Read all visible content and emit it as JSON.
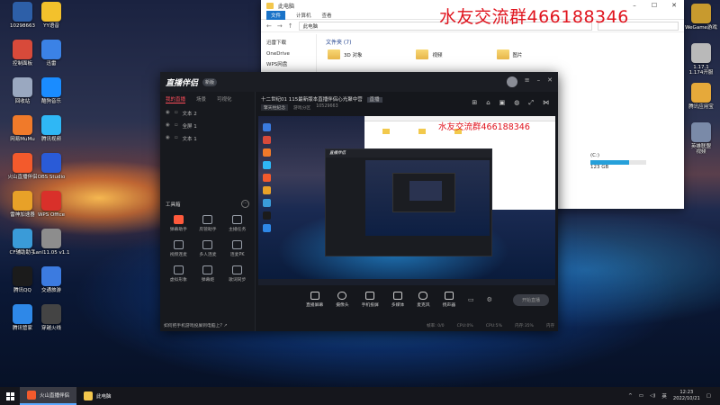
{
  "desktop": {
    "icons": [
      {
        "label": "10298663",
        "color": "#2d5fa8"
      },
      {
        "label": "YY语音",
        "color": "#f3c12c"
      },
      {
        "label": "控制面板",
        "color": "#d84a3a"
      },
      {
        "label": "迅雷",
        "color": "#3b82e6"
      },
      {
        "label": "回收站",
        "color": "#9aa8c0"
      },
      {
        "label": "酷狗音乐",
        "color": "#1a8cff"
      },
      {
        "label": "网易MuMu",
        "color": "#f07a2a"
      },
      {
        "label": "腾讯视频",
        "color": "#2fb7f5"
      },
      {
        "label": "火山直播伴侣",
        "color": "#f35a2c"
      },
      {
        "label": "OBS Studio",
        "color": "#2a5bd7"
      },
      {
        "label": "雷神加速器",
        "color": "#e8a128"
      },
      {
        "label": "WPS Office",
        "color": "#d9302a"
      },
      {
        "label": "CF辅助助手",
        "color": "#3a9bd8"
      },
      {
        "label": "Lanl11.05 v1.1",
        "color": "#8d8d8d"
      },
      {
        "label": "腾讯QQ",
        "color": "#1b1b1b"
      },
      {
        "label": "交通旅游",
        "color": "#3c7be0"
      },
      {
        "label": "腾讯管家",
        "color": "#2e88e8"
      },
      {
        "label": "穿越火线",
        "color": "#444"
      }
    ],
    "right_icons": [
      {
        "label": "WeGame游戏",
        "color": "#c89a2e"
      },
      {
        "label": "1.17.1\n1.174开服",
        "color": "#b9b9b9"
      },
      {
        "label": "腾讯应用宝",
        "color": "#e6a93a"
      },
      {
        "label": "英雄联盟\n视频",
        "color": "#7a8aa8"
      }
    ]
  },
  "explorer": {
    "title": "此电脑",
    "ribbon_tabs": [
      "文件",
      "计算机",
      "查看"
    ],
    "address": "此电脑",
    "sidebar": [
      "迅雷下载",
      "OneDrive",
      "WPS网盘"
    ],
    "group_title": "文件夹 (7)",
    "folders": [
      "3D 对象",
      "视频",
      "图片"
    ],
    "drive_label": "(C:)",
    "drive_size": "123 GB",
    "drive_fill": 0.7
  },
  "watermark": "水友交流群466188346",
  "app": {
    "logo": "直播伴侣",
    "badge": "新版",
    "tabs": [
      "我的直播",
      "场景",
      "可视化"
    ],
    "sources": [
      "文本 2",
      "全屏 1",
      "文本 1"
    ],
    "tools_title": "工具箱",
    "tools": [
      {
        "label": "弹幕助手",
        "hot": true
      },
      {
        "label": "房管助手",
        "hot": false
      },
      {
        "label": "主播任务",
        "hot": false
      },
      {
        "label": "视频连麦",
        "hot": false
      },
      {
        "label": "多人连麦",
        "hot": false
      },
      {
        "label": "连麦PK",
        "hot": false
      },
      {
        "label": "虚拟形象",
        "hot": false
      },
      {
        "label": "弹幕姬",
        "hot": false
      },
      {
        "label": "歌词同步",
        "hot": false
      }
    ],
    "stream_title": "十二世纪01 115最新版本直播伴侣心光聚中营",
    "live_tag": "直播",
    "sub_tag": "擎天柱纪念",
    "sub_items": [
      "游戏分区",
      "10529663"
    ],
    "controls": [
      "直播屏幕",
      "摄像头",
      "手机投屏",
      "多媒体",
      "麦克风",
      "扬声器"
    ],
    "start_label": "开始直播",
    "status": [
      "帧率: 0/0",
      "CPU:0%",
      "CPU:5%",
      "内存:35%",
      "内存"
    ],
    "hint": "如何把手机游戏投屏到电脑上?"
  },
  "taskbar": {
    "tasks": [
      "火山直播伴侣",
      "此电脑"
    ],
    "ime": "英",
    "time": "12:23",
    "date": "2022/10/21"
  }
}
